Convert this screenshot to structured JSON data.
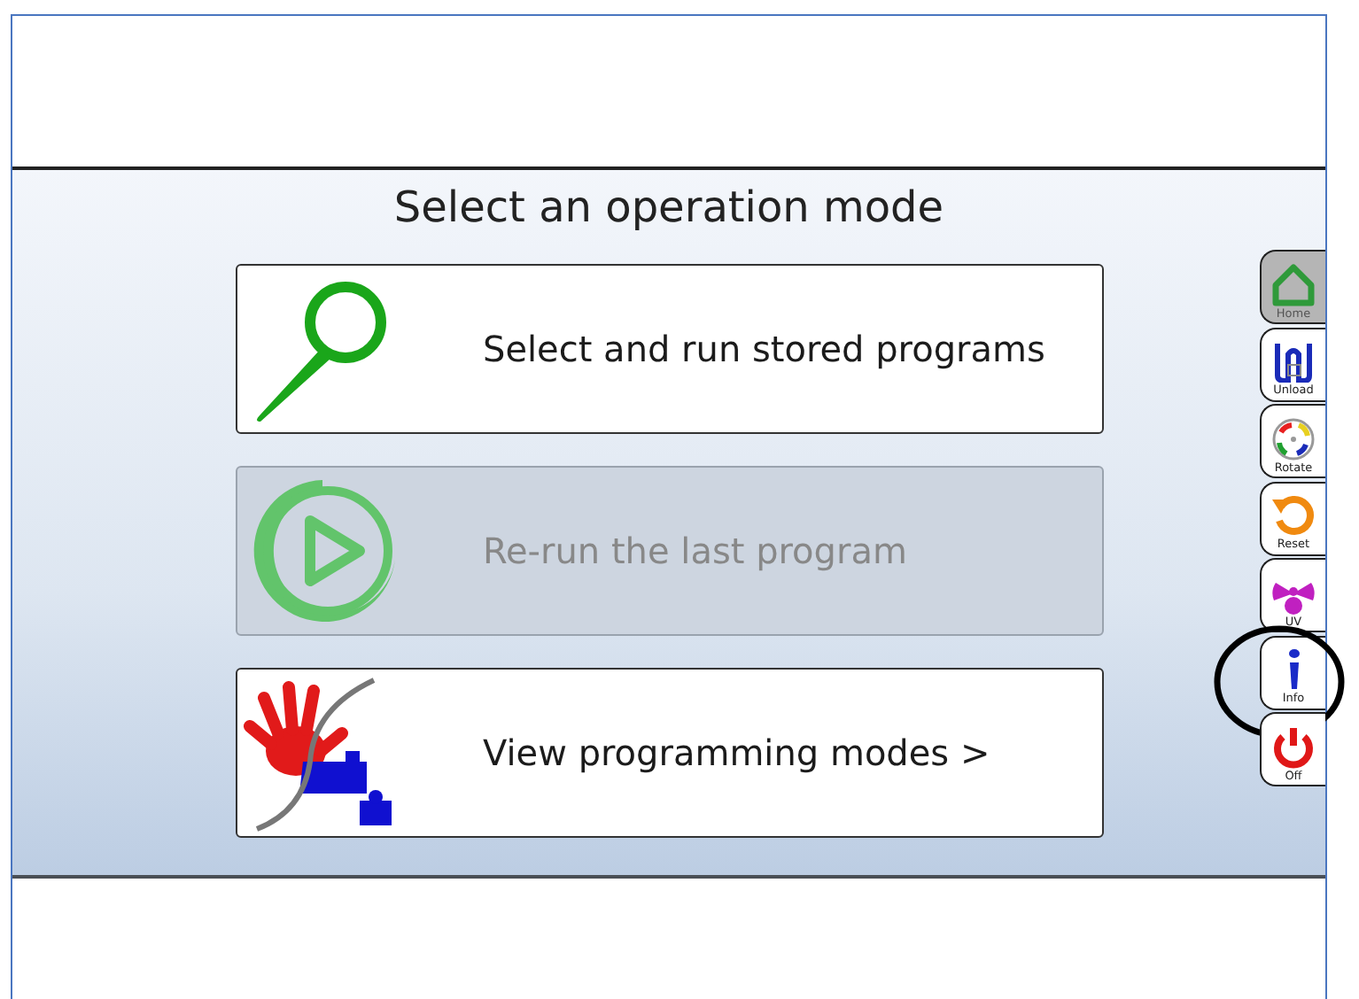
{
  "title": "Select an operation mode",
  "options": [
    {
      "label": "Select and run stored programs",
      "kind": "search",
      "disabled": false
    },
    {
      "label": "Re-run the last program",
      "kind": "play",
      "disabled": true
    },
    {
      "label": "View programming modes >",
      "kind": "hand-puzzle",
      "disabled": false
    }
  ],
  "side_buttons": [
    {
      "label": "Home",
      "kind": "home",
      "disabled": true,
      "circled": false
    },
    {
      "label": "Unload",
      "kind": "unload",
      "disabled": false,
      "circled": false
    },
    {
      "label": "Rotate",
      "kind": "rotate",
      "disabled": false,
      "circled": false
    },
    {
      "label": "Reset",
      "kind": "reset",
      "disabled": false,
      "circled": false
    },
    {
      "label": "UV",
      "kind": "uv",
      "disabled": false,
      "circled": false
    },
    {
      "label": "Info",
      "kind": "info",
      "disabled": false,
      "circled": true
    },
    {
      "label": "Off",
      "kind": "off",
      "disabled": false,
      "circled": false
    }
  ]
}
